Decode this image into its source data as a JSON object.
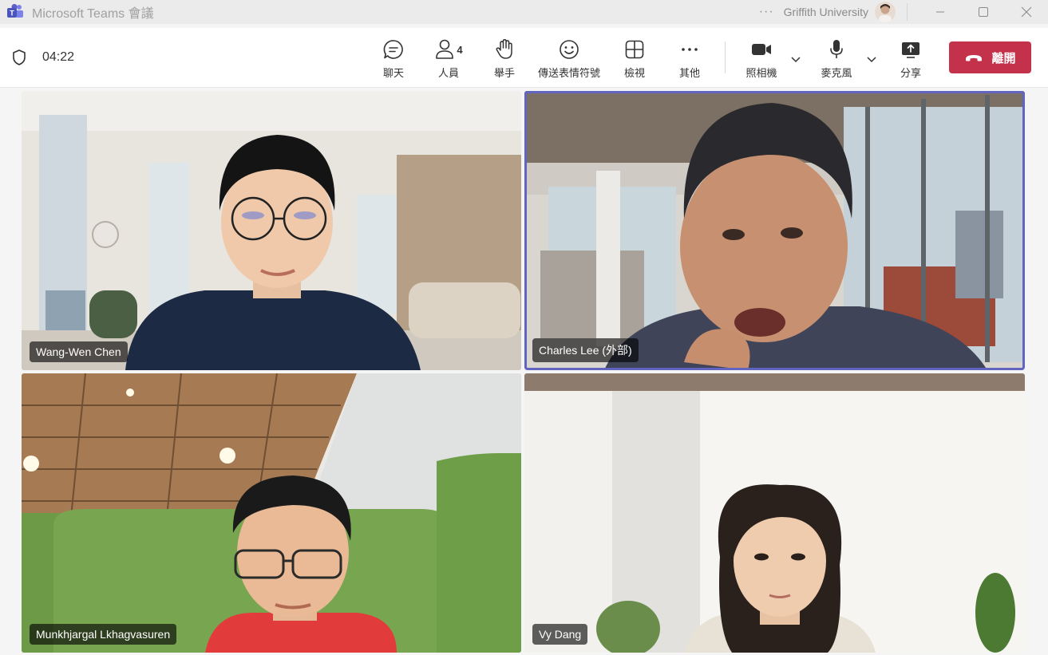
{
  "window": {
    "title": "Microsoft Teams 會議",
    "more": "···",
    "organization": "Griffith University"
  },
  "meeting": {
    "elapsed": "04:22",
    "people_count": "4"
  },
  "toolbar": {
    "chat_label": "聊天",
    "people_label": "人員",
    "raise_hand_label": "舉手",
    "reactions_label": "傳送表情符號",
    "view_label": "檢視",
    "more_label": "其他",
    "camera_label": "照相機",
    "mic_label": "麥克風",
    "share_label": "分享",
    "leave_label": "離開"
  },
  "participants": [
    {
      "name": "Wang-Wen Chen",
      "speaking": false
    },
    {
      "name": "Charles Lee (外部)",
      "speaking": true
    },
    {
      "name": "Munkhjargal Lkhagvasuren",
      "speaking": false
    },
    {
      "name": "Vy Dang",
      "speaking": false
    }
  ],
  "colors": {
    "accent": "#6264c2",
    "leave": "#c4314b",
    "teams_logo": "#5b5fc7"
  }
}
